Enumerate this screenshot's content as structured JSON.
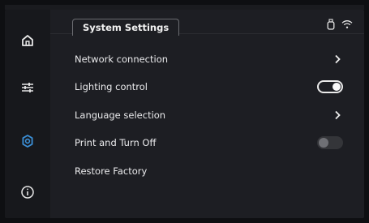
{
  "tab": {
    "title": "System Settings"
  },
  "sidebar": {
    "items": [
      {
        "icon": "home-icon",
        "active": false
      },
      {
        "icon": "sliders-icon",
        "active": false
      },
      {
        "icon": "settings-gear-icon",
        "active": true
      },
      {
        "icon": "info-icon",
        "active": false
      }
    ]
  },
  "status": {
    "icons": [
      "usb-drive-icon",
      "wifi-icon"
    ]
  },
  "settings": {
    "items": [
      {
        "label": "Network connection",
        "control": "chevron"
      },
      {
        "label": "Lighting control",
        "control": "toggle",
        "on": true
      },
      {
        "label": "Language selection",
        "control": "chevron"
      },
      {
        "label": "Print and Turn Off",
        "control": "toggle",
        "on": false
      },
      {
        "label": "Restore Factory",
        "control": "none"
      }
    ]
  },
  "colors": {
    "accent": "#3b8fd6",
    "background": "#1d1e23",
    "sidebar": "#17181c"
  }
}
